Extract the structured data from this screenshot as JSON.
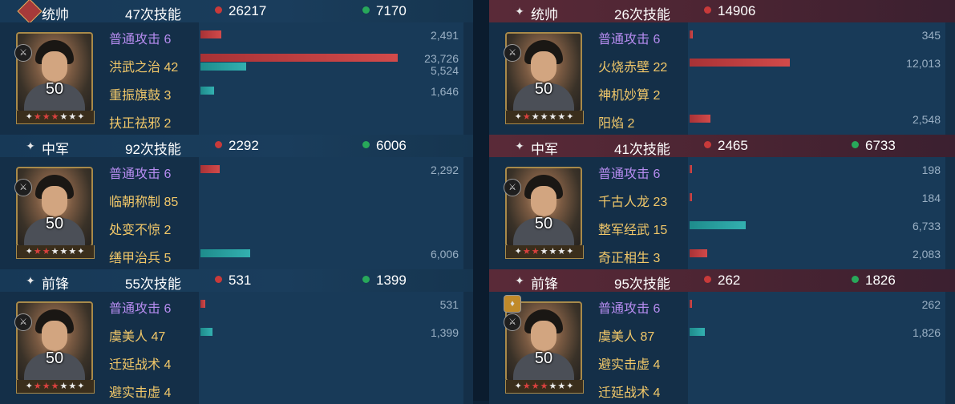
{
  "left": [
    {
      "role": "统帅",
      "role_badge": "commander-badge-icon",
      "skills": "47次技能",
      "damage": "26217",
      "heal": "7170",
      "level": "50",
      "stars_red": 3,
      "stars_white": 2,
      "type_icon": "cavalry-icon",
      "rows": [
        {
          "name": "普通攻击 6",
          "purple": true,
          "red": 2491,
          "red_label": "2,491"
        },
        {
          "name": "洪武之治 42",
          "red": 23726,
          "red_label": "23,726",
          "teal": 5524,
          "teal_label": "5,524"
        },
        {
          "name": "重振旗鼓 3",
          "teal": 1646,
          "teal_label": "1,646"
        },
        {
          "name": "扶正祛邪 2"
        }
      ]
    },
    {
      "role": "中军",
      "skills": "92次技能",
      "damage": "2292",
      "heal": "6006",
      "level": "50",
      "stars_red": 2,
      "stars_white": 3,
      "type_icon": "shield-icon",
      "rows": [
        {
          "name": "普通攻击 6",
          "purple": true,
          "red": 2292,
          "red_label": "2,292"
        },
        {
          "name": "临朝称制 85"
        },
        {
          "name": "处变不惊 2"
        },
        {
          "name": "缮甲治兵 5",
          "teal": 6006,
          "teal_label": "6,006"
        }
      ]
    },
    {
      "role": "前锋",
      "skills": "55次技能",
      "damage": "531",
      "heal": "1399",
      "level": "50",
      "stars_red": 3,
      "stars_white": 2,
      "type_icon": "shield-icon",
      "rows": [
        {
          "name": "普通攻击 6",
          "purple": true,
          "red": 531,
          "red_label": "531"
        },
        {
          "name": "虞美人  47",
          "teal": 1399,
          "teal_label": "1,399"
        },
        {
          "name": "迁延战术 4"
        },
        {
          "name": "避实击虚 4"
        }
      ]
    }
  ],
  "right": [
    {
      "role": "统帅",
      "skills": "26次技能",
      "damage": "14906",
      "heal": "",
      "level": "50",
      "stars_red": 1,
      "stars_white": 4,
      "type_icon": "cavalry-icon",
      "rows": [
        {
          "name": "普通攻击 6",
          "purple": true,
          "red": 345,
          "red_label": "345"
        },
        {
          "name": "火烧赤壁 22",
          "red": 12013,
          "red_label": "12,013"
        },
        {
          "name": "神机妙算 2"
        },
        {
          "name": "阳焰   2",
          "red": 2548,
          "red_label": "2,548"
        }
      ]
    },
    {
      "role": "中军",
      "skills": "41次技能",
      "damage": "2465",
      "heal": "6733",
      "level": "50",
      "stars_red": 2,
      "stars_white": 3,
      "type_icon": "shield-icon",
      "rows": [
        {
          "name": "普通攻击 6",
          "purple": true,
          "red": 198,
          "red_label": "198"
        },
        {
          "name": "千古人龙 23",
          "red": 184,
          "red_label": "184"
        },
        {
          "name": "整军经武 15",
          "teal": 6733,
          "teal_label": "6,733"
        },
        {
          "name": "奇正相生 3",
          "red": 2083,
          "red_label": "2,083"
        }
      ]
    },
    {
      "role": "前锋",
      "skills": "95次技能",
      "damage": "262",
      "heal": "1826",
      "level": "50",
      "stars_red": 3,
      "stars_white": 2,
      "type_icon": "shield-icon",
      "extra_icon": "archer-icon",
      "rows": [
        {
          "name": "普通攻击 6",
          "purple": true,
          "red": 262,
          "red_label": "262"
        },
        {
          "name": "虞美人  87",
          "teal": 1826,
          "teal_label": "1,826"
        },
        {
          "name": "避实击虚 4"
        },
        {
          "name": "迁延战术 4"
        }
      ]
    }
  ]
}
